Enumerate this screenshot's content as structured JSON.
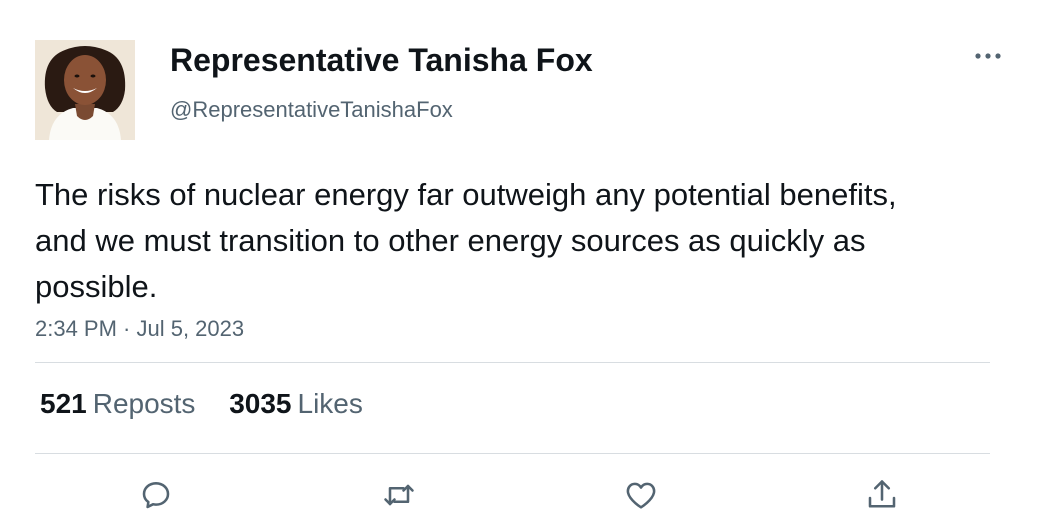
{
  "author": {
    "display_name": "Representative Tanisha Fox",
    "handle": "@RepresentativeTanishaFox"
  },
  "tweet": {
    "text": "The risks of nuclear energy far outweigh any potential benefits, and we must transition to other energy sources as quickly as possible.",
    "timestamp": "2:34 PM · Jul 5, 2023"
  },
  "stats": {
    "reposts_count": "521",
    "reposts_label": "Reposts",
    "likes_count": "3035",
    "likes_label": "Likes"
  },
  "actions": {
    "reply_icon": "reply-icon",
    "repost_icon": "repost-icon",
    "like_icon": "heart-icon",
    "share_icon": "share-icon",
    "more_icon": "more-options-icon"
  },
  "colors": {
    "primary_text": "#0f1419",
    "secondary_text": "#536471",
    "divider": "#d8dde1"
  }
}
